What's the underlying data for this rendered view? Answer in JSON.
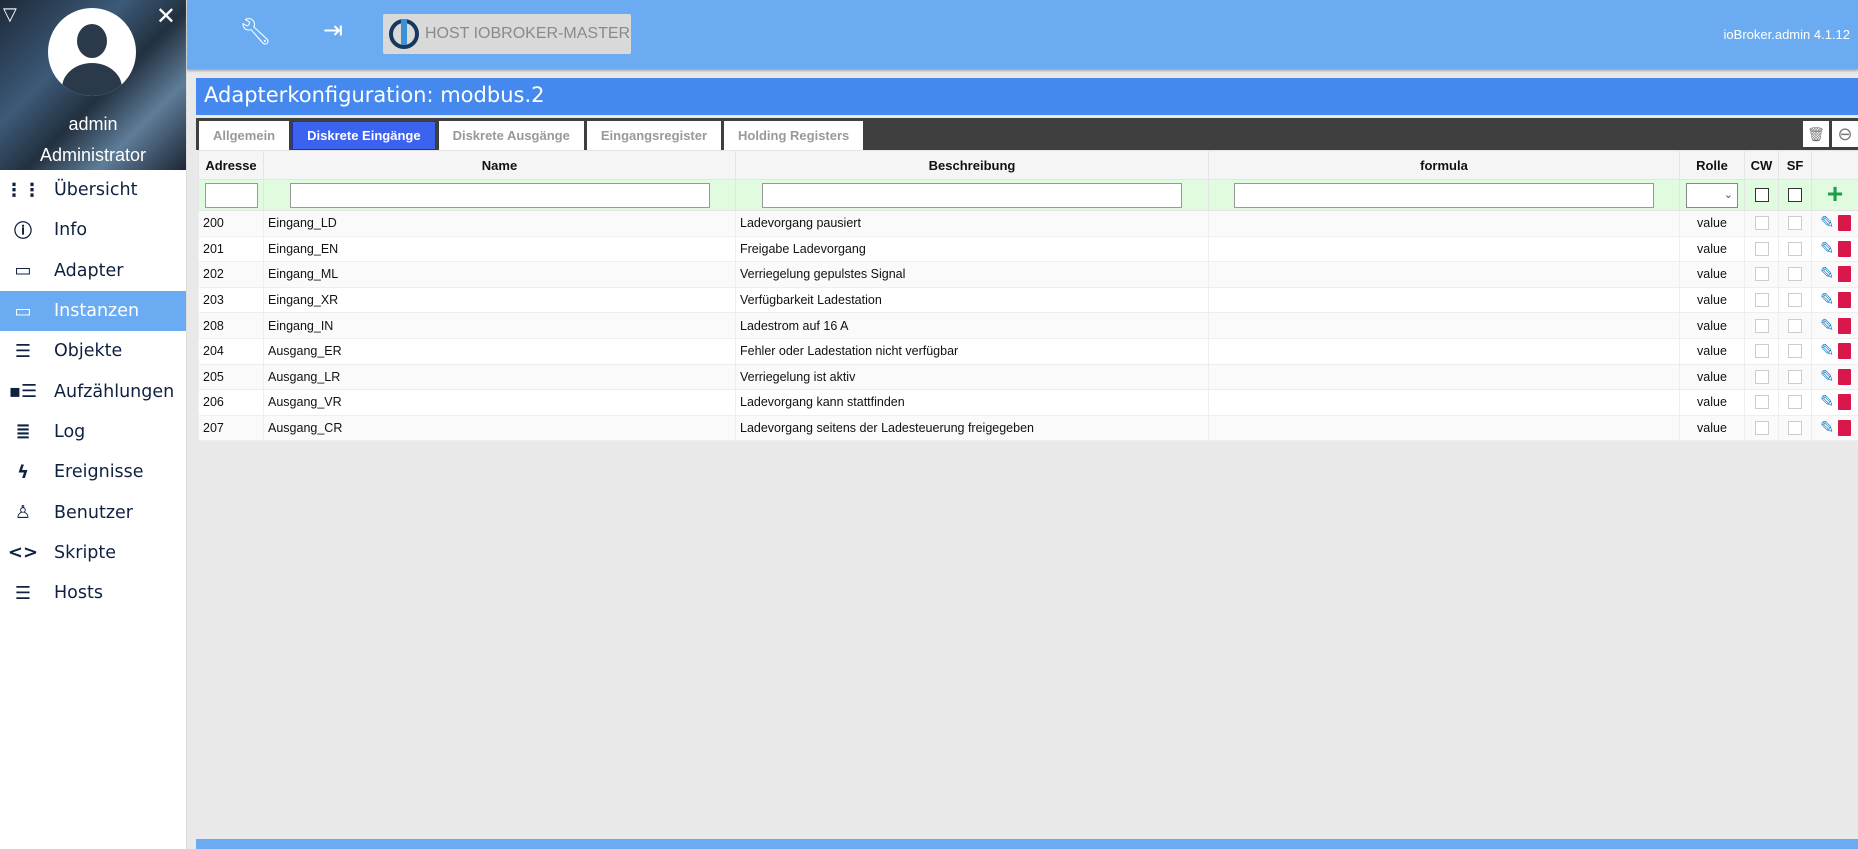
{
  "sidebar": {
    "user": "admin",
    "role": "Administrator",
    "items": [
      {
        "label": "Übersicht",
        "icon": "grid-icon"
      },
      {
        "label": "Info",
        "icon": "info-icon"
      },
      {
        "label": "Adapter",
        "icon": "store-icon"
      },
      {
        "label": "Instanzen",
        "icon": "instances-icon",
        "active": true
      },
      {
        "label": "Objekte",
        "icon": "list-icon"
      },
      {
        "label": "Aufzählungen",
        "icon": "enum-icon"
      },
      {
        "label": "Log",
        "icon": "log-icon"
      },
      {
        "label": "Ereignisse",
        "icon": "bolt-icon"
      },
      {
        "label": "Benutzer",
        "icon": "user-icon"
      },
      {
        "label": "Skripte",
        "icon": "code-icon"
      },
      {
        "label": "Hosts",
        "icon": "server-icon"
      }
    ]
  },
  "topbar": {
    "host": "HOST IOBROKER-MASTER",
    "version": "ioBroker.admin 4.1.12"
  },
  "title": "Adapterkonfiguration: modbus.2",
  "tabs": [
    "Allgemein",
    "Diskrete Eingänge",
    "Diskrete Ausgänge",
    "Eingangsregister",
    "Holding Registers"
  ],
  "active_tab": 1,
  "table": {
    "headers": [
      "Adresse",
      "Name",
      "Beschreibung",
      "formula",
      "Rolle",
      "CW",
      "SF"
    ],
    "rows": [
      {
        "address": "200",
        "name": "Eingang_LD",
        "desc": "Ladevorgang pausiert",
        "formula": "",
        "role": "value"
      },
      {
        "address": "201",
        "name": "Eingang_EN",
        "desc": "Freigabe Ladevorgang",
        "formula": "",
        "role": "value"
      },
      {
        "address": "202",
        "name": "Eingang_ML",
        "desc": "Verriegelung gepulstes Signal",
        "formula": "",
        "role": "value"
      },
      {
        "address": "203",
        "name": "Eingang_XR",
        "desc": "Verfügbarkeit Ladestation",
        "formula": "",
        "role": "value"
      },
      {
        "address": "208",
        "name": "Eingang_IN",
        "desc": "Ladestrom auf 16 A",
        "formula": "",
        "role": "value"
      },
      {
        "address": "204",
        "name": "Ausgang_ER",
        "desc": "Fehler oder Ladestation nicht verfügbar",
        "formula": "",
        "role": "value"
      },
      {
        "address": "205",
        "name": "Ausgang_LR",
        "desc": "Verriegelung ist aktiv",
        "formula": "",
        "role": "value"
      },
      {
        "address": "206",
        "name": "Ausgang_VR",
        "desc": "Ladevorgang kann stattfinden",
        "formula": "",
        "role": "value"
      },
      {
        "address": "207",
        "name": "Ausgang_CR",
        "desc": "Ladevorgang seitens der Ladesteuerung freigegeben",
        "formula": "",
        "role": "value"
      }
    ]
  }
}
